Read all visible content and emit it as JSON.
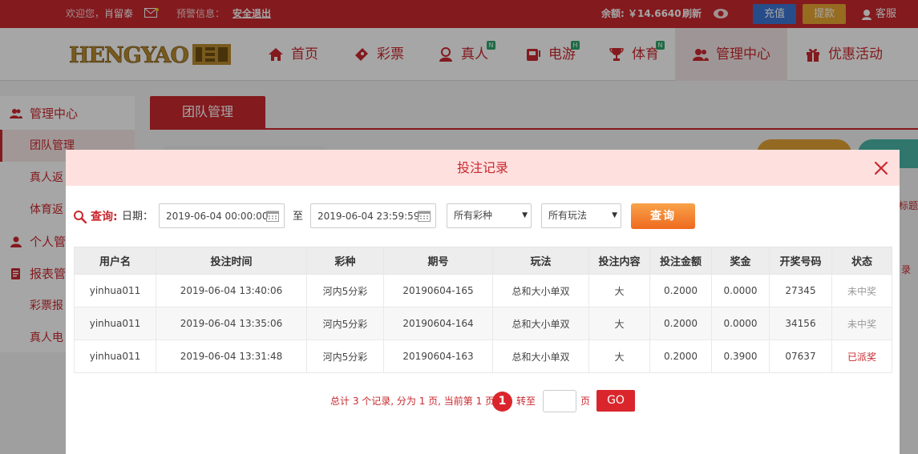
{
  "topbar": {
    "welcome_prefix": "欢迎您，",
    "username": "肖留泰",
    "warning_label": "预警信息：",
    "logout": "安全退出",
    "balance_label": "余额: ￥14.6640",
    "refresh": "刷新",
    "recharge": "充值",
    "withdraw": "提款",
    "service": "客服"
  },
  "nav": {
    "logo_text": "HENGYAO 恒耀",
    "items": [
      {
        "label": "首页",
        "icon": "home-icon"
      },
      {
        "label": "彩票",
        "icon": "ticket-icon"
      },
      {
        "label": "真人",
        "icon": "dealer-icon",
        "badge": "N"
      },
      {
        "label": "电游",
        "icon": "slot-icon",
        "badge": "H"
      },
      {
        "label": "体育",
        "icon": "trophy-icon",
        "badge": "N"
      },
      {
        "label": "管理中心",
        "icon": "users-icon"
      },
      {
        "label": "优惠活动",
        "icon": "gift-icon"
      }
    ]
  },
  "sidebar": {
    "section1": "管理中心",
    "items1": [
      "团队管理",
      "真人返",
      "体育返"
    ],
    "section2": "个人管",
    "section3": "报表管",
    "items3": [
      "彩票报",
      "真人电"
    ]
  },
  "content": {
    "tab": "团队管理",
    "edge_right_1": "标题",
    "edge_right_2": "录"
  },
  "modal": {
    "title": "投注记录",
    "filter": {
      "query_label": "查询:",
      "date_label": "日期：",
      "start": "2019-06-04 00:00:00",
      "to": "至",
      "end": "2019-06-04 23:59:59",
      "lottery_select": "所有彩种",
      "play_select": "所有玩法",
      "button": "查询"
    },
    "table": {
      "headers": [
        "用户名",
        "投注时间",
        "彩种",
        "期号",
        "玩法",
        "投注内容",
        "投注金额",
        "奖金",
        "开奖号码",
        "状态"
      ],
      "rows": [
        [
          "yinhua011",
          "2019-06-04 13:40:06",
          "河内5分彩",
          "20190604-165",
          "总和大小单双",
          "大",
          "0.2000",
          "0.0000",
          "27345",
          "未中奖"
        ],
        [
          "yinhua011",
          "2019-06-04 13:35:06",
          "河内5分彩",
          "20190604-164",
          "总和大小单双",
          "大",
          "0.2000",
          "0.0000",
          "34156",
          "未中奖"
        ],
        [
          "yinhua011",
          "2019-06-04 13:31:48",
          "河内5分彩",
          "20190604-163",
          "总和大小单双",
          "大",
          "0.2000",
          "0.3900",
          "07637",
          "已派奖"
        ]
      ]
    },
    "pager": {
      "summary": "总计 3 个记录, 分为 1 页, 当前第 1 页",
      "current": "1",
      "goto": "转至",
      "page": "页",
      "go": "GO"
    }
  },
  "colors": {
    "brand_red": "#c9282e",
    "modal_head": "#fee1df",
    "query_button": "#ef6a1f",
    "recharge": "#3d76d4",
    "withdraw": "#e7a733"
  }
}
